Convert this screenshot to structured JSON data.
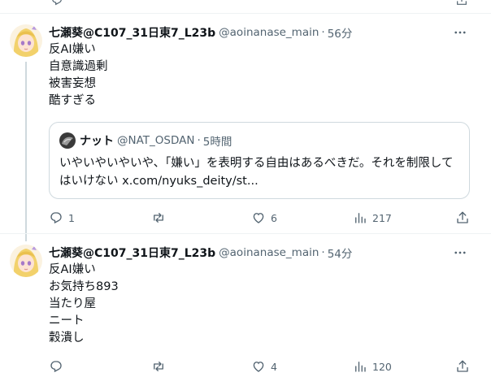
{
  "tweets": [
    {
      "display_name": "七瀬葵@C107_31日東7_L23b",
      "handle": "@aoinanase_main",
      "separator": "·",
      "time": "56分",
      "lines": [
        "反AI嫌い",
        "自意識過剰",
        "被害妄想",
        "酷すぎる"
      ],
      "quote": {
        "display_name": "ナット",
        "handle": "@NAT_OSDAN",
        "separator": "·",
        "time": "5時間",
        "text": "いやいやいやいや、「嫌い」を表明する自由はあるべきだ。それを制限してはいけない x.com/nyuks_deity/st..."
      },
      "actions": {
        "replies": "1",
        "reposts": "",
        "likes": "6",
        "views": "217"
      }
    },
    {
      "display_name": "七瀬葵@C107_31日東7_L23b",
      "handle": "@aoinanase_main",
      "separator": "·",
      "time": "54分",
      "lines": [
        "反AI嫌い",
        "お気持ち893",
        "当たり屋",
        "ニート",
        "穀潰し"
      ],
      "actions": {
        "replies": "",
        "reposts": "",
        "likes": "4",
        "views": "120"
      }
    }
  ],
  "icons": {
    "reply": "reply-icon",
    "repost": "repost-icon",
    "like": "heart-icon",
    "views": "views-icon",
    "share": "share-icon",
    "more": "more-icon"
  },
  "colors": {
    "text": "#0f1419",
    "secondary": "#536471",
    "border": "#cfd9de",
    "divider": "#eff3f4"
  }
}
